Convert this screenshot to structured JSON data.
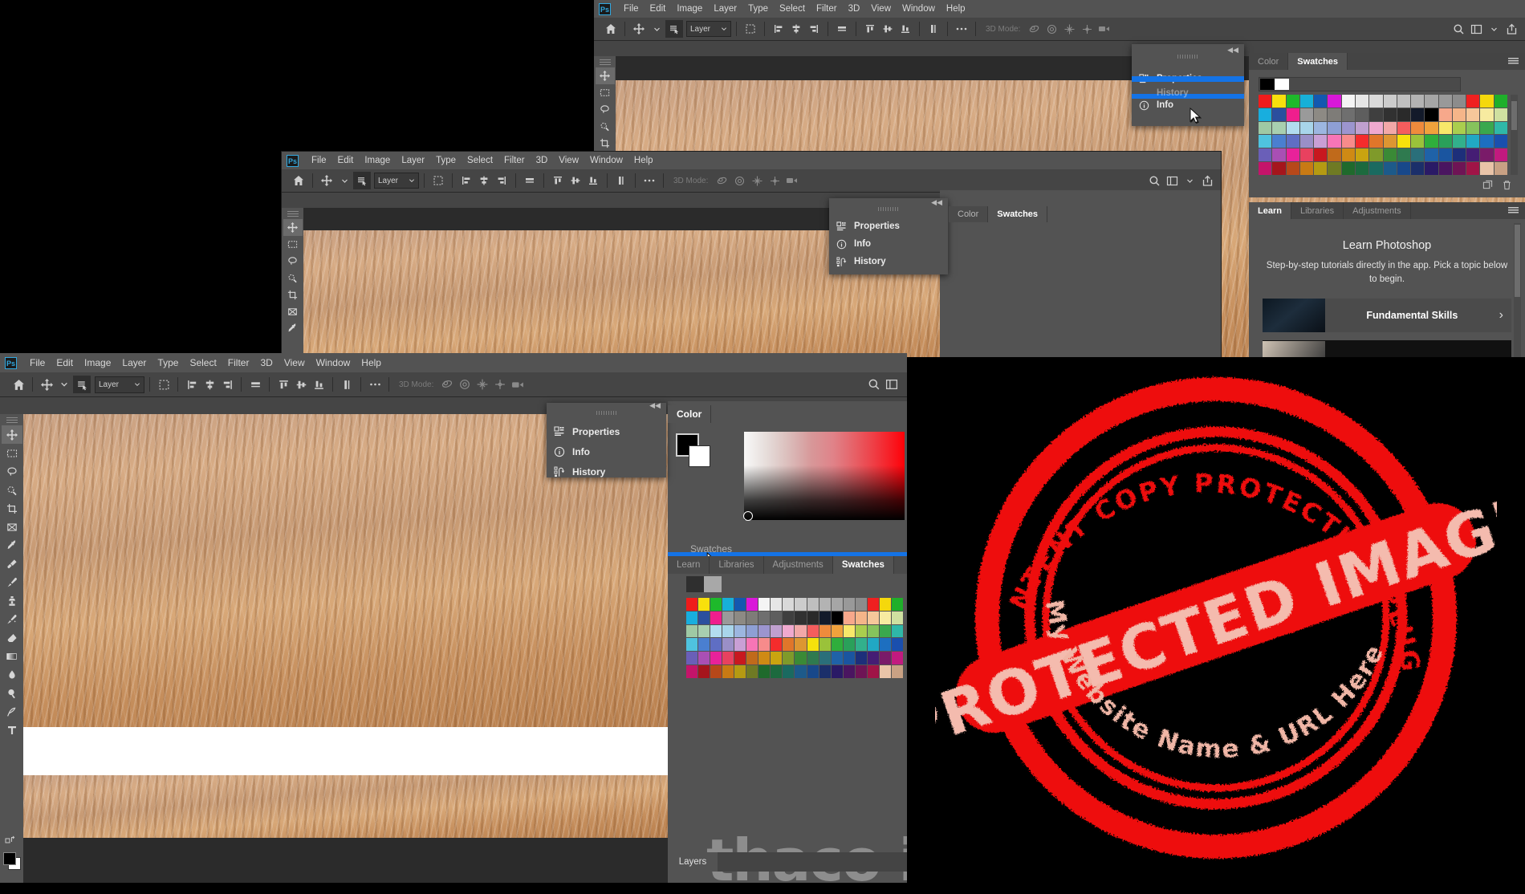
{
  "app": {
    "name": "Adobe Photoshop",
    "logo": "Ps",
    "menu": [
      "File",
      "Edit",
      "Image",
      "Layer",
      "Type",
      "Select",
      "Filter",
      "3D",
      "View",
      "Window",
      "Help"
    ]
  },
  "option_bar": {
    "home_icon": "home-icon",
    "move_tool_icon": "move-tool-icon",
    "chevron": "chevron-down-icon",
    "auto_select_icon": "auto-select-layers-icon",
    "layer_select_value": "Layer",
    "transform_controls_icon": "show-transform-controls-icon",
    "align_icons": [
      "align-left-edges",
      "align-horizontal-centers",
      "align-right-edges",
      "distribute-horizontal"
    ],
    "align_icons2": [
      "align-top-edges",
      "align-vertical-centers",
      "align-bottom-edges",
      "distribute-vertical"
    ],
    "more_icon": "more-options-icon",
    "mode_label": "3D Mode:",
    "mode_icons": [
      "orbit-3d-camera",
      "roll-3d-camera",
      "pan-3d-camera",
      "slide-3d-camera",
      "zoom-3d-camera"
    ],
    "search_icon": "search-icon",
    "workspace_icon": "arrange-documents-icon",
    "share_icon": "share-icon"
  },
  "toolbar": {
    "tools": [
      {
        "name": "move-tool",
        "active": true
      },
      {
        "name": "rectangular-marquee-tool",
        "active": false
      },
      {
        "name": "lasso-tool",
        "active": false
      },
      {
        "name": "quick-selection-tool",
        "active": false
      },
      {
        "name": "crop-tool",
        "active": false
      },
      {
        "name": "frame-tool",
        "active": false
      },
      {
        "name": "eyedropper-tool",
        "active": false
      },
      {
        "name": "spot-healing-brush-tool",
        "active": false
      },
      {
        "name": "brush-tool",
        "active": false
      },
      {
        "name": "clone-stamp-tool",
        "active": false
      },
      {
        "name": "history-brush-tool",
        "active": false
      },
      {
        "name": "eraser-tool",
        "active": false
      },
      {
        "name": "gradient-tool",
        "active": false
      },
      {
        "name": "blur-tool",
        "active": false
      },
      {
        "name": "dodge-tool",
        "active": false
      },
      {
        "name": "pen-tool",
        "active": false
      },
      {
        "name": "type-tool",
        "active": false
      }
    ]
  },
  "flyout_menu": {
    "items": [
      {
        "label": "Properties",
        "icon": "properties-icon"
      },
      {
        "label": "Info",
        "icon": "info-icon"
      },
      {
        "label": "History",
        "icon": "history-icon"
      }
    ],
    "collapse_icon": "collapse-to-icons-icon"
  },
  "flyout_menu_top": {
    "items": [
      {
        "label": "Properties",
        "icon": "properties-icon"
      },
      {
        "label": "History",
        "icon": "history-icon",
        "dragging": true
      },
      {
        "label": "Info",
        "icon": "info-icon"
      }
    ],
    "collapse_icon": "collapse-to-icons-icon"
  },
  "color_swatches_panel": {
    "tabs": [
      {
        "label": "Color",
        "active": false
      },
      {
        "label": "Swatches",
        "active": true
      }
    ],
    "menu_icon": "panel-menu-icon",
    "foreground_color": "#000000",
    "background_color": "#ffffff",
    "swatch_rows": [
      [
        "#f01b1b",
        "#f8e00c",
        "#1eb92b",
        "#17b0d8",
        "#1358b0",
        "#d918d9",
        "#f4f4f4",
        "#e6e6e6",
        "#d9d9d9",
        "#cccccc",
        "#bfbfbf",
        "#b3b3b3",
        "#a6a6a6",
        "#999999",
        "#8c8c8c",
        "#ef2020",
        "#f5d80c",
        "#1faf2a"
      ],
      [
        "#18aede",
        "#2b4f9e",
        "#ef1e8d",
        "#9a9a9a",
        "#8d8a84",
        "#7e7c78",
        "#6f6f6f",
        "#5e5e5e",
        "#3f3f3f",
        "#313131",
        "#2a2a2a",
        "#131a2a",
        "#000000",
        "#f7a88b",
        "#f5b589",
        "#f6c79a",
        "#f7eba0",
        "#cfe0a0"
      ],
      [
        "#9fc9a4",
        "#a8cfb0",
        "#b2dcef",
        "#a8d5ea",
        "#9cb6e0",
        "#8e9fd4",
        "#9c95cf",
        "#c0a0cf",
        "#f0a9cf",
        "#f2a8a8",
        "#f45d5d",
        "#ef8b3c",
        "#f0a23c",
        "#f8e86a",
        "#aace4e",
        "#86c35c",
        "#3aa84e",
        "#2fb8a8"
      ],
      [
        "#4fc3df",
        "#4a7fd0",
        "#5f6ec4",
        "#9a8fc7",
        "#c99fd5",
        "#f775b6",
        "#f78b8b",
        "#f42c2c",
        "#e0762a",
        "#dd9632",
        "#f5e10c",
        "#9ac23a",
        "#2fae3c",
        "#2aa05a",
        "#32b08c",
        "#21a8c4",
        "#1d6fc0",
        "#1a4fae"
      ],
      [
        "#6a5fb8",
        "#a94fb4",
        "#e8229a",
        "#e8415f",
        "#c8181f",
        "#c06a1b",
        "#cf8a14",
        "#c9a410",
        "#7f9a2a",
        "#3a8a36",
        "#2f7a4f",
        "#2a6f7a",
        "#1f62a8",
        "#1a55a0",
        "#1d2f7a",
        "#451d74",
        "#7a1b69",
        "#c21a7f"
      ],
      [
        "#c4146a",
        "#a5151c",
        "#b7481a",
        "#c87a14",
        "#b59a12",
        "#6f7a24",
        "#1f6a2c",
        "#1c6a3e",
        "#1a6a60",
        "#1d5a8a",
        "#18488a",
        "#1b2f6a",
        "#2a1a66",
        "#4a1560",
        "#6e1455",
        "#a01447",
        "#eac4a8",
        "#c9a184"
      ]
    ],
    "new_swatch_icon": "new-swatch-icon",
    "delete_swatch_icon": "delete-swatch-icon",
    "scroll_up_icon": "scroll-up-icon",
    "scroll_down_icon": "scroll-down-icon"
  },
  "learn_panel": {
    "tabs": [
      {
        "label": "Learn",
        "active": true
      },
      {
        "label": "Libraries",
        "active": false
      },
      {
        "label": "Adjustments",
        "active": false
      }
    ],
    "menu_icon": "panel-menu-icon",
    "title": "Learn Photoshop",
    "subtitle": "Step-by-step tutorials directly in the app. Pick a topic below to begin.",
    "cards": [
      {
        "title": "Fundamental Skills",
        "chevron": "chevron-right-icon"
      }
    ]
  },
  "front_window": {
    "color_panel": {
      "tabs": [
        {
          "label": "Color",
          "active": true
        }
      ],
      "foreground_color": "#000000",
      "background_color": "#ffffff"
    },
    "dock_tabs": [
      {
        "label": "Learn",
        "active": false
      },
      {
        "label": "Libraries",
        "active": false
      },
      {
        "label": "Adjustments",
        "active": false
      },
      {
        "label": "Swatches",
        "active": true
      }
    ],
    "dragged_tab": "Swatches",
    "layers_tab": "Layers",
    "swatch_rows": [
      [
        "#f01b1b",
        "#f8e00c",
        "#1eb92b",
        "#17b0d8",
        "#1358b0",
        "#d918d9",
        "#f4f4f4",
        "#e6e6e6",
        "#d9d9d9",
        "#cccccc",
        "#bfbfbf",
        "#b3b3b3",
        "#a6a6a6",
        "#999999",
        "#8c8c8c",
        "#ef2020",
        "#f5d80c",
        "#1faf2a"
      ],
      [
        "#18aede",
        "#2b4f9e",
        "#ef1e8d",
        "#9a9a9a",
        "#8d8a84",
        "#7e7c78",
        "#6f6f6f",
        "#5e5e5e",
        "#3f3f3f",
        "#313131",
        "#2a2a2a",
        "#131a2a",
        "#000000",
        "#f7a88b",
        "#f5b589",
        "#f6c79a",
        "#f7eba0",
        "#cfe0a0"
      ],
      [
        "#9fc9a4",
        "#a8cfb0",
        "#b2dcef",
        "#a8d5ea",
        "#9cb6e0",
        "#8e9fd4",
        "#9c95cf",
        "#c0a0cf",
        "#f0a9cf",
        "#f2a8a8",
        "#f45d5d",
        "#ef8b3c",
        "#f0a23c",
        "#f8e86a",
        "#aace4e",
        "#86c35c",
        "#3aa84e",
        "#2fb8a8"
      ],
      [
        "#4fc3df",
        "#4a7fd0",
        "#5f6ec4",
        "#9a8fc7",
        "#c99fd5",
        "#f775b6",
        "#f78b8b",
        "#f42c2c",
        "#e0762a",
        "#dd9632",
        "#f5e10c",
        "#9ac23a",
        "#2fae3c",
        "#2aa05a",
        "#32b08c",
        "#21a8c4",
        "#1d6fc0",
        "#1a4fae"
      ],
      [
        "#6a5fb8",
        "#a94fb4",
        "#e8229a",
        "#e8415f",
        "#c8181f",
        "#c06a1b",
        "#cf8a14",
        "#c9a410",
        "#7f9a2a",
        "#3a8a36",
        "#2f7a4f",
        "#2a6f7a",
        "#1f62a8",
        "#1a55a0",
        "#1d2f7a",
        "#451d74",
        "#7a1b69",
        "#c21a7f"
      ],
      [
        "#c4146a",
        "#a5151c",
        "#b7481a",
        "#c87a14",
        "#b59a12",
        "#6f7a24",
        "#1f6a2c",
        "#1c6a3e",
        "#1a6a60",
        "#1d5a8a",
        "#18488a",
        "#1b2f6a",
        "#2a1a66",
        "#4a1560",
        "#6e1455",
        "#a01447",
        "#eac4a8",
        "#c9a184"
      ]
    ]
  },
  "watermark": {
    "background_text": "thaco i",
    "stamp": {
      "outer_text": "CONTENT COPY PROTECTION PLUGIN",
      "banner_text": "PROTECTED IMAGE",
      "bottom_text": "My Website Name & URL Here",
      "color": "#ee1111",
      "banner_text_color": "#f4bbae"
    }
  },
  "cursor": {
    "name": "arrow-pointer",
    "positions": [
      "top-window-flyout",
      "front-window-dock-tabs"
    ]
  },
  "accent_colors": {
    "selection_blue": "#1473e6",
    "photoshop_blue": "#31a8e0",
    "panel_gray": "#535353",
    "chrome_gray": "#454545",
    "canvas_dark": "#2b2b2b"
  }
}
